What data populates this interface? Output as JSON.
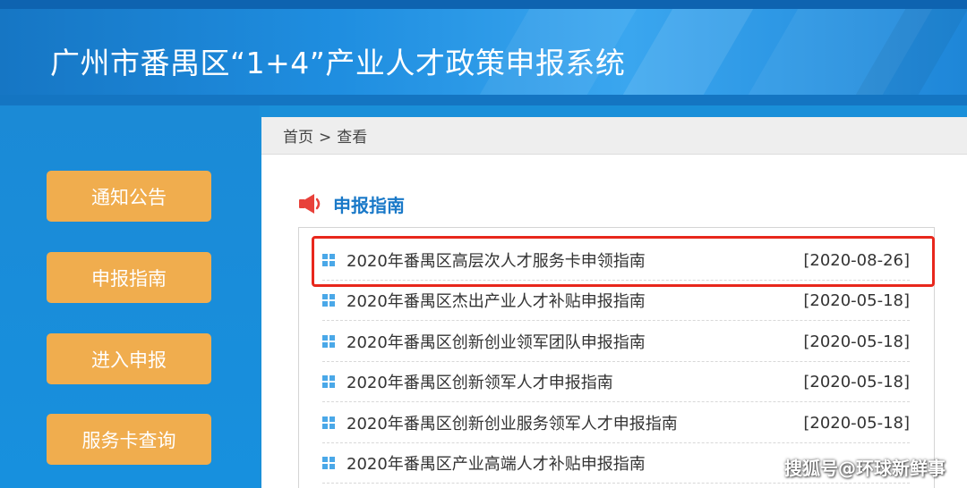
{
  "header": {
    "title": "广州市番禺区“1+4”产业人才政策申报系统"
  },
  "sidebar": {
    "items": [
      {
        "label": "通知公告"
      },
      {
        "label": "申报指南"
      },
      {
        "label": "进入申报"
      },
      {
        "label": "服务卡查询"
      }
    ]
  },
  "breadcrumb": {
    "home": "首页",
    "separator": ">",
    "current": "查看"
  },
  "section": {
    "title": "申报指南",
    "icon": "speaker-icon"
  },
  "list": {
    "items": [
      {
        "title": "2020年番禺区高层次人才服务卡申领指南",
        "date": "[2020-08-26]"
      },
      {
        "title": "2020年番禺区杰出产业人才补贴申报指南",
        "date": "[2020-05-18]"
      },
      {
        "title": "2020年番禺区创新创业领军团队申报指南",
        "date": "[2020-05-18]"
      },
      {
        "title": "2020年番禺区创新领军人才申报指南",
        "date": "[2020-05-18]"
      },
      {
        "title": "2020年番禺区创新创业服务领军人才申报指南",
        "date": "[2020-05-18]"
      },
      {
        "title": "2020年番禺区产业高端人才补贴申报指南",
        "date": ""
      }
    ]
  },
  "watermark": "搜狐号@环球新鲜事",
  "colors": {
    "header_blue": "#1f8ee0",
    "sidebar_blue": "#1790de",
    "nav_button": "#f0ad4e",
    "section_title": "#1a79c8",
    "highlight_border": "#e8271c",
    "speaker_red": "#e8413a",
    "bullet_blue": "#4aa8e8"
  }
}
